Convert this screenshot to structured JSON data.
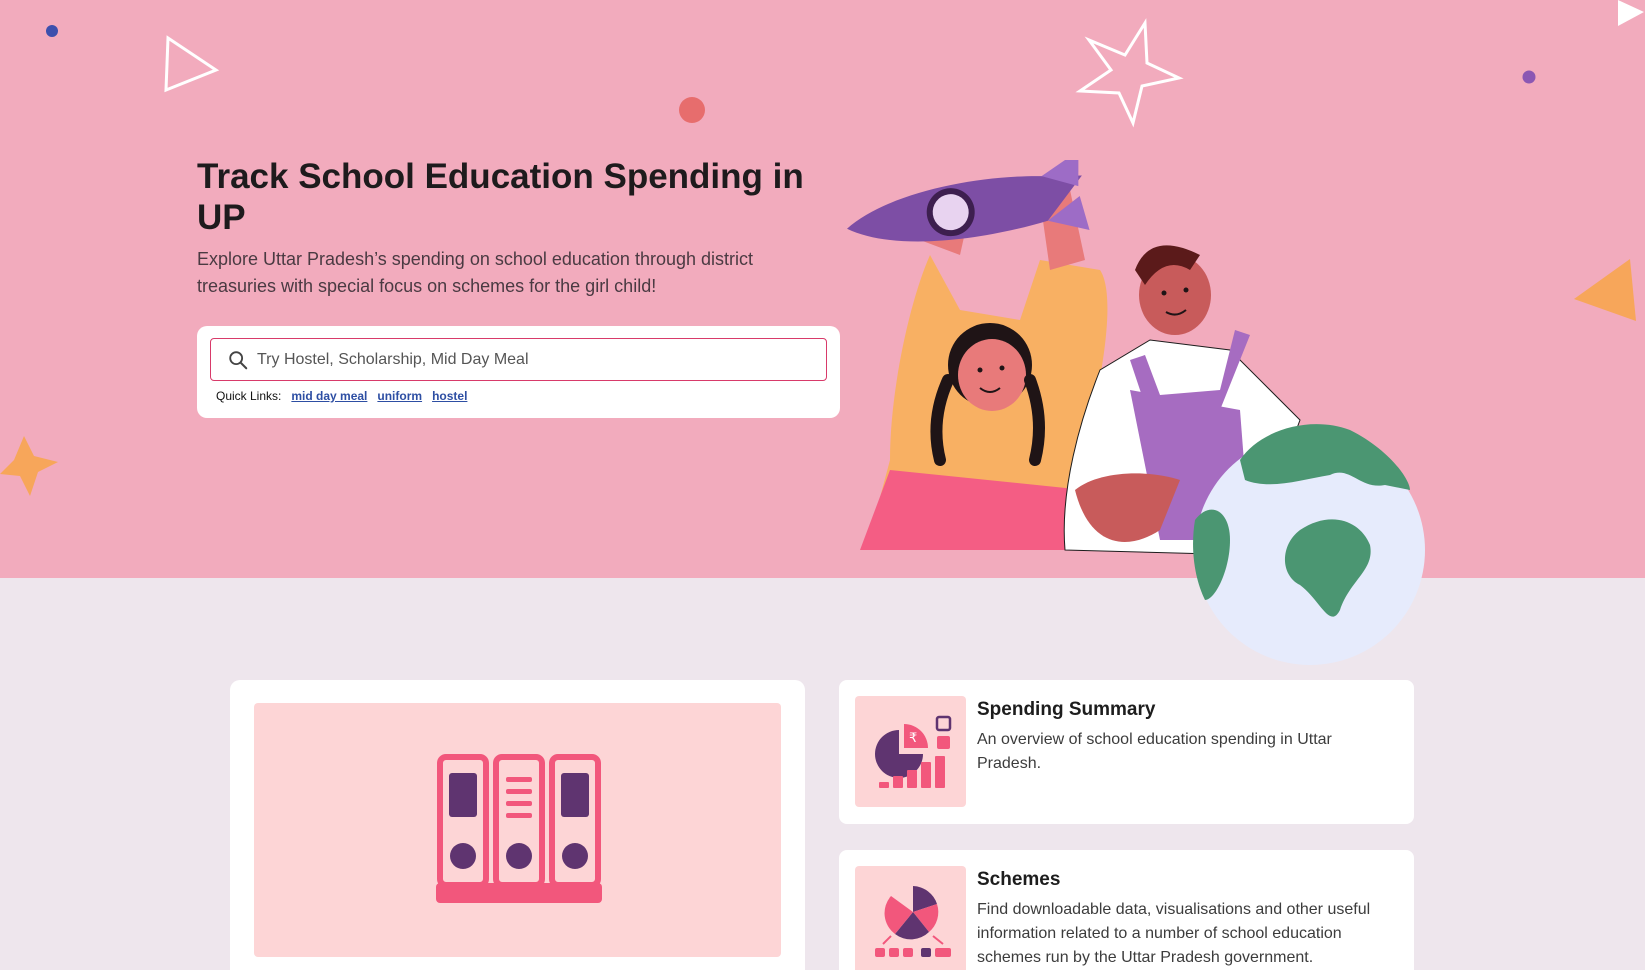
{
  "hero": {
    "title": "Track School Education Spending in UP",
    "subtitle": "Explore Uttar Pradesh’s spending on school education through district treasuries with special focus on schemes for the girl child!",
    "background_color": "#f2abbd"
  },
  "search": {
    "placeholder": "Try Hostel, Scholarship, Mid Day Meal",
    "value": "",
    "quick_links_label": "Quick Links:",
    "quick_links": [
      "mid day meal",
      "uniform",
      "hostel"
    ]
  },
  "cards": [
    {
      "title": "Spending Summary",
      "description": "An overview of school education spending in Uttar Pradesh.",
      "icon": "spending-summary-icon"
    },
    {
      "title": "Schemes",
      "description": "Find downloadable data, visualisations and other useful information related to a number of school education schemes run by the Uttar Pradesh government.",
      "icon": "schemes-icon"
    }
  ],
  "featured_icon": "ledger-binders-icon",
  "colors": {
    "accent": "#f2577c",
    "purple": "#5f3470",
    "card_thumb_bg": "#fdd5d6",
    "link": "#2d4ea3"
  }
}
